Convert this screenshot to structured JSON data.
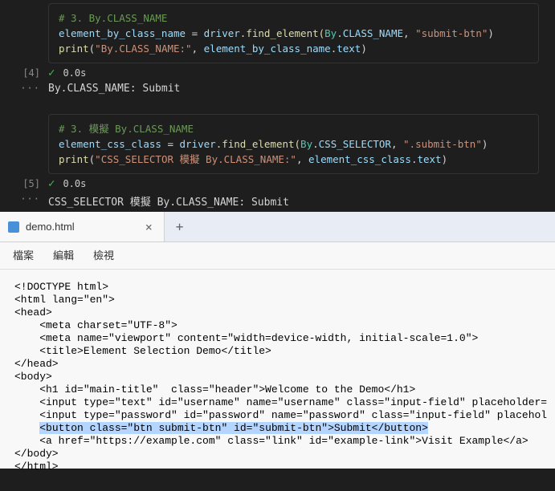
{
  "cell1": {
    "comment": "# 3. By.CLASS_NAME",
    "line2_pre": "element_by_class_name ",
    "line2_eq": "=",
    "line2_driver": " driver",
    "line2_find": ".find_element(",
    "line2_by": "By",
    "line2_dot2": ".",
    "line2_attr": "CLASS_NAME",
    "line2_comma": ", ",
    "line2_str": "\"submit-btn\"",
    "line2_close": ")",
    "line3_print": "print",
    "line3_open": "(",
    "line3_str": "\"By.CLASS_NAME:\"",
    "line3_comma": ", ",
    "line3_var": "element_by_class_name",
    "line3_dot": ".",
    "line3_text": "text",
    "line3_close": ")",
    "index": "[4]",
    "time": "0.0s",
    "output": "By.CLASS_NAME: Submit"
  },
  "cell2": {
    "comment": "# 3. 模擬 By.CLASS_NAME",
    "line2_pre": "element_css_class ",
    "line2_eq": "=",
    "line2_driver": " driver",
    "line2_find": ".find_element(",
    "line2_by": "By",
    "line2_dot2": ".",
    "line2_attr": "CSS_SELECTOR",
    "line2_comma": ", ",
    "line2_str": "\".submit-btn\"",
    "line2_close": ")",
    "line3_print": "print",
    "line3_open": "(",
    "line3_str": "\"CSS_SELECTOR 模擬 By.CLASS_NAME:\"",
    "line3_comma": ", ",
    "line3_var": "element_css_class",
    "line3_dot": ".",
    "line3_text": "text",
    "line3_close": ")",
    "index": "[5]",
    "time": "0.0s",
    "output": "CSS_SELECTOR 模擬 By.CLASS_NAME: Submit"
  },
  "editor": {
    "tab_title": "demo.html",
    "menu": {
      "file": "檔案",
      "edit": "編輯",
      "view": "檢視"
    },
    "lines": {
      "l1": "<!DOCTYPE html>",
      "l2": "<html lang=\"en\">",
      "l3": "<head>",
      "l4": "    <meta charset=\"UTF-8\">",
      "l5": "    <meta name=\"viewport\" content=\"width=device-width, initial-scale=1.0\">",
      "l6": "    <title>Element Selection Demo</title>",
      "l7": "</head>",
      "l8": "<body>",
      "l9": "    <h1 id=\"main-title\"  class=\"header\">Welcome to the Demo</h1>",
      "l10": "    <input type=\"text\" id=\"username\" name=\"username\" class=\"input-field\" placeholder=",
      "l11": "    <input type=\"password\" id=\"password\" name=\"password\" class=\"input-field\" placehol",
      "l12a": "    ",
      "l12b": "<button class=\"btn submit-btn\" id=\"submit-btn\">Submit</button>",
      "l13": "    <a href=\"https://example.com\" class=\"link\" id=\"example-link\">Visit Example</a>",
      "l14": "</body>",
      "l15": "</html>"
    }
  }
}
